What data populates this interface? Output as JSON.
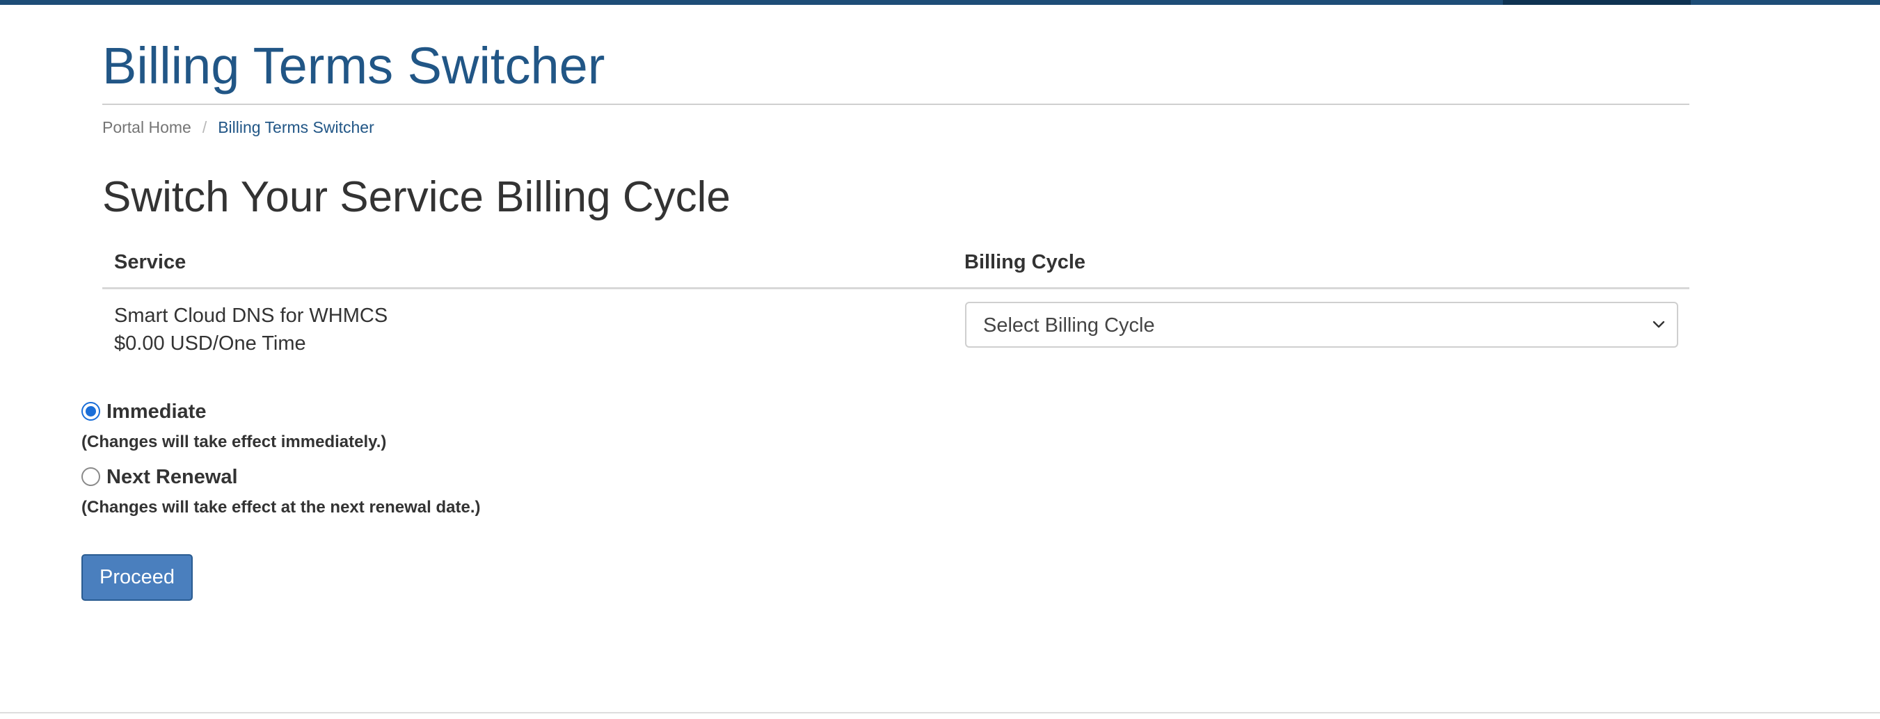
{
  "page_title": "Billing Terms Switcher",
  "breadcrumb": {
    "home": "Portal Home",
    "separator": "/",
    "current": "Billing Terms Switcher"
  },
  "section_title": "Switch Your Service Billing Cycle",
  "table": {
    "headers": [
      "Service",
      "Billing Cycle"
    ],
    "rows": [
      {
        "service_name": "Smart Cloud DNS for WHMCS",
        "service_price": "$0.00 USD/One Time",
        "billing_cycle_select": {
          "selected": "Select Billing Cycle"
        }
      }
    ]
  },
  "timing_options": [
    {
      "label": "Immediate",
      "description": "(Changes will take effect immediately.)",
      "checked": true
    },
    {
      "label": "Next Renewal",
      "description": "(Changes will take effect at the next renewal date.)",
      "checked": false
    }
  ],
  "proceed_button": "Proceed",
  "colors": {
    "brand_primary": "#215686",
    "top_bar": "#1e4d77",
    "button_bg": "#4a7fbe",
    "radio_checked": "#1a6ed8"
  },
  "icons": {
    "select_chevron": "chevron-down-icon"
  }
}
